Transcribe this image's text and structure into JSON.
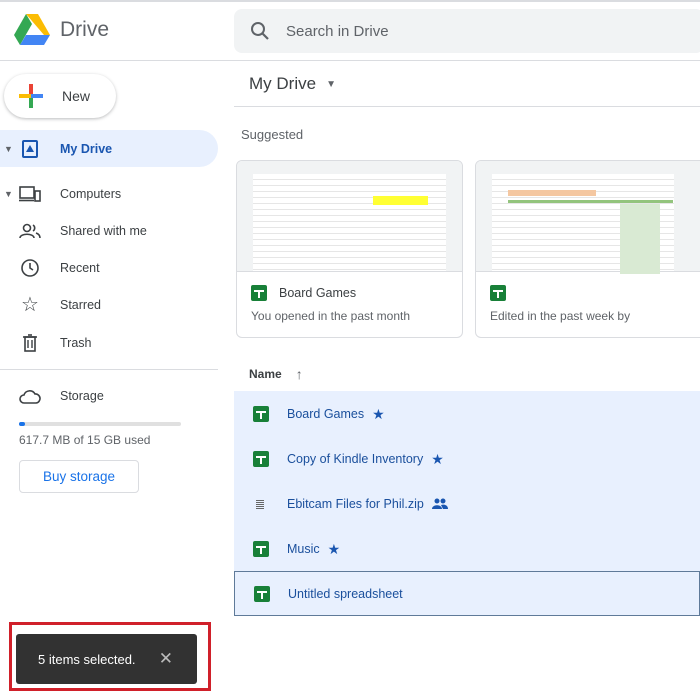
{
  "app": {
    "name": "Drive"
  },
  "search": {
    "placeholder": "Search in Drive"
  },
  "sidebar": {
    "new_label": "New",
    "items": [
      {
        "label": "My Drive",
        "icon": "my-drive-icon",
        "active": true
      },
      {
        "label": "Computers",
        "icon": "computers-icon"
      },
      {
        "label": "Shared with me",
        "icon": "shared-icon"
      },
      {
        "label": "Recent",
        "icon": "clock-icon"
      },
      {
        "label": "Starred",
        "icon": "star-icon"
      },
      {
        "label": "Trash",
        "icon": "trash-icon"
      }
    ],
    "storage": {
      "label": "Storage",
      "usage_text": "617.7 MB of 15 GB used",
      "used_percent": 4,
      "buy_label": "Buy storage"
    }
  },
  "main": {
    "title": "My Drive",
    "suggested_label": "Suggested",
    "cards": [
      {
        "name": "Board Games",
        "subtitle": "You opened in the past month"
      },
      {
        "name": "",
        "subtitle": "Edited in the past week by"
      }
    ],
    "column_name": "Name",
    "files": [
      {
        "name": "Board Games",
        "type": "sheet",
        "badge": "star"
      },
      {
        "name": "Copy of Kindle Inventory",
        "type": "sheet",
        "badge": "star"
      },
      {
        "name": "Ebitcam Files for Phil.zip",
        "type": "zip",
        "badge": "shared"
      },
      {
        "name": "Music",
        "type": "sheet",
        "badge": "star"
      },
      {
        "name": "Untitled spreadsheet",
        "type": "sheet",
        "badge": ""
      }
    ]
  },
  "toast": {
    "text": "5 items selected."
  },
  "colors": {
    "accent": "#1a73e8",
    "selected_bg": "#e8f0fe",
    "sheets_green": "#188038",
    "highlight": "#d0202a"
  }
}
